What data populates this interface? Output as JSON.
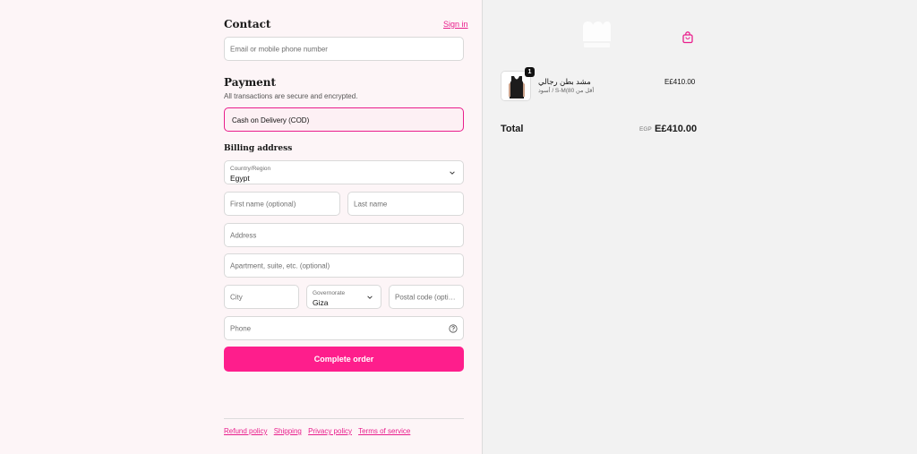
{
  "contact": {
    "title": "Contact",
    "sign_in": "Sign in",
    "email_placeholder": "Email or mobile phone number"
  },
  "payment": {
    "title": "Payment",
    "subtitle": "All transactions are secure and encrypted.",
    "method": "Cash on Delivery (COD)"
  },
  "billing": {
    "title": "Billing address",
    "country_label": "Country/Region",
    "country_value": "Egypt",
    "first_name_placeholder": "First name (optional)",
    "last_name_placeholder": "Last name",
    "address_placeholder": "Address",
    "apartment_placeholder": "Apartment, suite, etc. (optional)",
    "city_placeholder": "City",
    "governorate_label": "Governorate",
    "governorate_value": "Giza",
    "postal_placeholder": "Postal code (option…",
    "phone_placeholder": "Phone"
  },
  "actions": {
    "complete_order": "Complete order"
  },
  "footer": {
    "links": [
      "Refund policy",
      "Shipping",
      "Privacy policy",
      "Terms of service"
    ]
  },
  "summary": {
    "item": {
      "quantity": "1",
      "name": "مشد بطن رجالي",
      "variant": "أسود / S-M(أقل من 80",
      "price": "E£410.00"
    },
    "total_label": "Total",
    "currency": "EGP",
    "total_value": "E£410.00"
  },
  "colors": {
    "accent": "#fe1e8c",
    "left_bg": "#fdf5f7",
    "right_bg": "#f2f2f2"
  },
  "icons": {
    "brand": "brand-logo",
    "bag": "shopping-bag-icon",
    "chevron": "chevron-down-icon",
    "help": "help-circle-icon"
  }
}
